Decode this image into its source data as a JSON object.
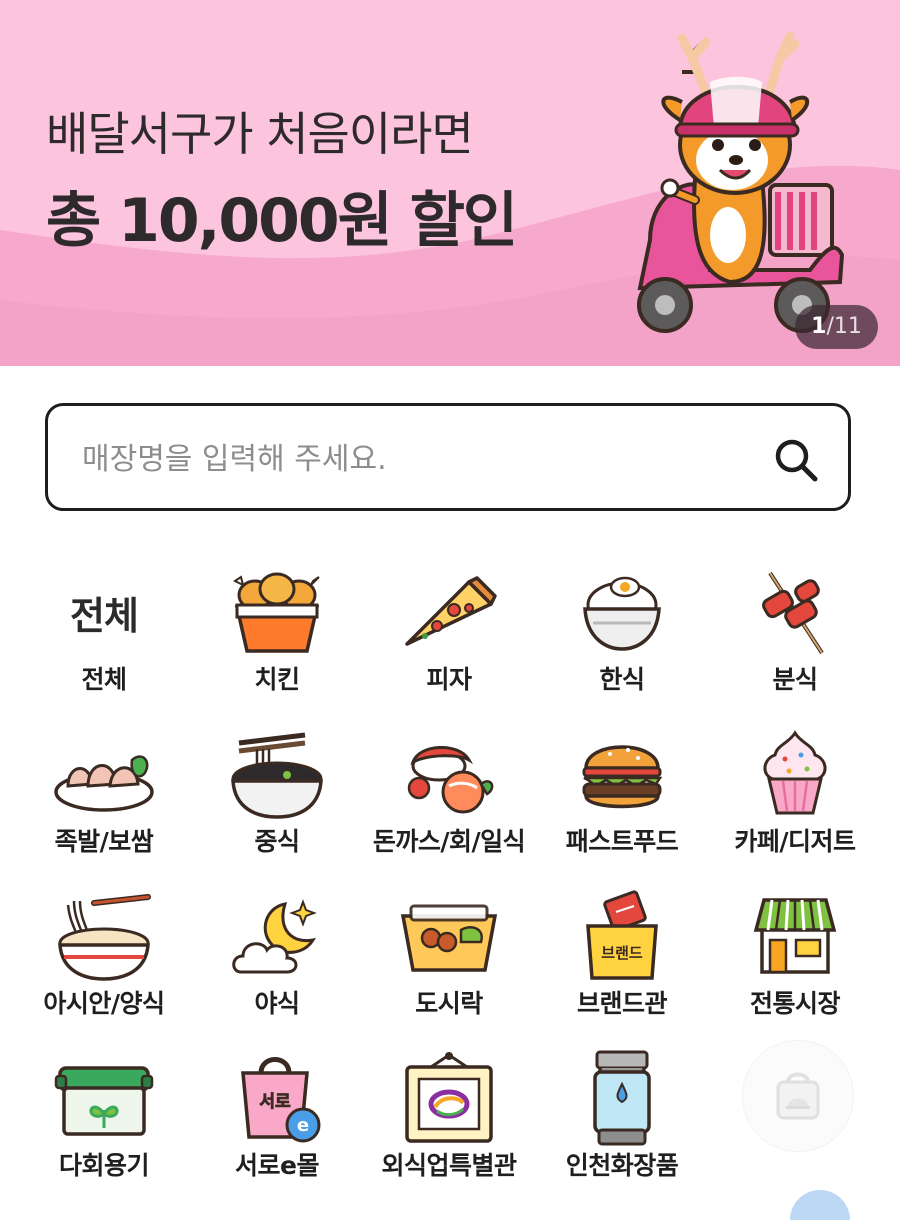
{
  "banner": {
    "line1": "배달서구가 처음이라면",
    "line2": "총 10,000원 할인",
    "pager_current": "1",
    "pager_total": "/11",
    "colors": {
      "bg": "#fdc4de",
      "wave": "#f6a9cc",
      "text": "#2e2a2c"
    }
  },
  "search": {
    "placeholder": "매장명을 입력해 주세요.",
    "value": "",
    "icon": "search-icon"
  },
  "categories": [
    {
      "label": "전체",
      "icon_text": "전체",
      "icon": "all-text-icon"
    },
    {
      "label": "치킨",
      "icon": "chicken-bucket-icon"
    },
    {
      "label": "피자",
      "icon": "pizza-slice-icon"
    },
    {
      "label": "한식",
      "icon": "rice-bowl-icon"
    },
    {
      "label": "분식",
      "icon": "skewer-icon"
    },
    {
      "label": "족발/보쌈",
      "icon": "pork-plate-icon"
    },
    {
      "label": "중식",
      "icon": "noodle-bowl-icon"
    },
    {
      "label": "돈까스/회/일식",
      "icon": "sushi-icon"
    },
    {
      "label": "패스트푸드",
      "icon": "burger-icon"
    },
    {
      "label": "카페/디저트",
      "icon": "cupcake-icon"
    },
    {
      "label": "아시안/양식",
      "icon": "pasta-bowl-icon"
    },
    {
      "label": "야식",
      "icon": "moon-cloud-icon"
    },
    {
      "label": "도시락",
      "icon": "lunchbox-icon"
    },
    {
      "label": "브랜드관",
      "icon_text": "브랜드",
      "icon": "brand-bag-icon"
    },
    {
      "label": "전통시장",
      "icon": "market-store-icon"
    },
    {
      "label": "다회용기",
      "icon": "reusable-container-icon"
    },
    {
      "label": "서로e몰",
      "icon_text": "서로",
      "icon_badge": "e",
      "icon": "shopping-bag-icon"
    },
    {
      "label": "외식업특별관",
      "icon": "framed-logo-icon"
    },
    {
      "label": "인천화장품",
      "icon": "cosmetics-bottle-icon"
    }
  ],
  "fab": {
    "icon": "delivery-bag-icon"
  }
}
